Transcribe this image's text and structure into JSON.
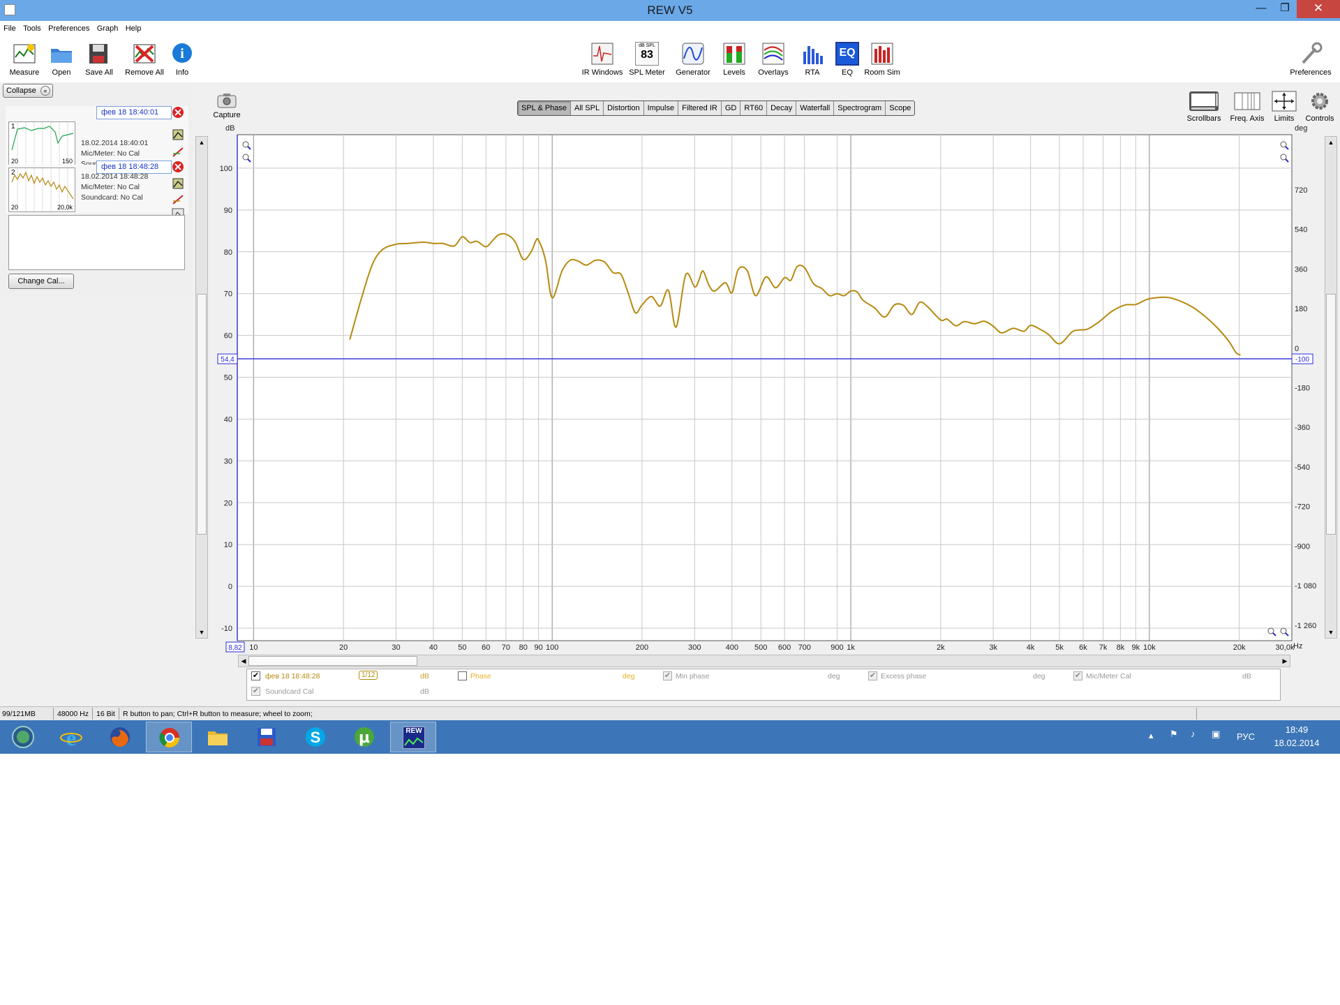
{
  "window": {
    "title": "REW V5",
    "min": "—",
    "max": "❐",
    "close": "✕"
  },
  "menu": [
    "File",
    "Tools",
    "Preferences",
    "Graph",
    "Help"
  ],
  "toolbar": {
    "left": [
      "Measure",
      "Open",
      "Save All",
      "Remove All",
      "Info"
    ],
    "center": [
      "IR Windows",
      "SPL Meter",
      "Generator",
      "Levels",
      "Overlays",
      "RTA",
      "EQ",
      "Room Sim"
    ],
    "spl_value": "83",
    "spl_label": "dB SPL",
    "eq_icon_text": "EQ",
    "right": "Preferences"
  },
  "left_panel": {
    "collapse": "Collapse",
    "measurements": [
      {
        "number": "1",
        "name": "фев 18 18:40:01",
        "date": "18.02.2014 18:40:01",
        "mic": "Mic/Meter: No Cal",
        "soundcard": "Soundcard: No Cal",
        "axis_min": "20",
        "axis_max": "150",
        "trace_color": "#1aa04a"
      },
      {
        "number": "2",
        "name": "фев 18 18:48:28",
        "date": "18.02.2014 18:48:28",
        "mic": "Mic/Meter: No Cal",
        "soundcard": "Soundcard: No Cal",
        "axis_min": "20",
        "axis_max": "20,0k",
        "trace_color": "#b58a10"
      }
    ],
    "change_cal": "Change Cal..."
  },
  "capture": "Capture",
  "tabs": [
    "SPL & Phase",
    "All SPL",
    "Distortion",
    "Impulse",
    "Filtered IR",
    "GD",
    "RT60",
    "Decay",
    "Waterfall",
    "Spectrogram",
    "Scope"
  ],
  "active_tab": "SPL & Phase",
  "right_tools": [
    "Scrollbars",
    "Freq. Axis",
    "Limits",
    "Controls"
  ],
  "chart_data": {
    "type": "line",
    "xscale": "log",
    "xlim": [
      8.82,
      30000
    ],
    "ylim": [
      -13,
      108
    ],
    "y2lim": [
      -1330,
      970
    ],
    "ylabel": "dB",
    "y2label": "deg",
    "xunit": "Hz",
    "grid": true,
    "yticks": [
      100,
      90,
      80,
      70,
      60,
      50,
      40,
      30,
      20,
      10,
      0,
      -10
    ],
    "ytick_labels": [
      "100",
      "90",
      "80",
      "70",
      "60",
      "50",
      "40",
      "30",
      "20",
      "10",
      "0",
      "-10"
    ],
    "y2ticks": [
      720,
      540,
      360,
      180,
      0,
      -180,
      -360,
      -540,
      -720,
      -900,
      -1080,
      -1260
    ],
    "y2tick_labels": [
      "720",
      "540",
      "360",
      "180",
      "0",
      "-180",
      "-360",
      "-540",
      "-720",
      "-900",
      "-1 080",
      "-1 260"
    ],
    "xticks": [
      10,
      20,
      30,
      40,
      50,
      60,
      70,
      80,
      90,
      100,
      200,
      300,
      400,
      500,
      600,
      700,
      900,
      1000,
      2000,
      3000,
      4000,
      5000,
      6000,
      7000,
      8000,
      9000,
      10000,
      20000
    ],
    "xtick_labels": [
      "10",
      "20",
      "30",
      "40",
      "50",
      "60",
      "70",
      "80",
      "90",
      "100",
      "200",
      "300",
      "400",
      "500",
      "600",
      "700",
      "900",
      "1k",
      "2k",
      "3k",
      "4k",
      "5k",
      "6k",
      "7k",
      "8k",
      "9k",
      "10k",
      "20k"
    ],
    "x_min_label": "8,82",
    "x_max_label": "30,0k",
    "cursor": {
      "y": 54.4,
      "left_label": "54,4",
      "right_label": "-100"
    },
    "series": [
      {
        "name": "фев 18 18:48:28",
        "color": "#b58a10",
        "x": [
          21,
          23,
          25,
          27,
          30,
          33,
          37,
          40,
          43,
          47,
          50,
          53,
          56,
          60,
          63,
          66,
          70,
          75,
          80,
          85,
          88,
          90,
          95,
          100,
          108,
          115,
          122,
          130,
          140,
          150,
          160,
          170,
          180,
          190,
          200,
          215,
          230,
          245,
          260,
          280,
          300,
          310,
          320,
          335,
          350,
          380,
          400,
          420,
          450,
          480,
          520,
          560,
          600,
          630,
          660,
          700,
          750,
          800,
          850,
          900,
          950,
          1000,
          1050,
          1100,
          1200,
          1300,
          1400,
          1500,
          1600,
          1700,
          1800,
          2000,
          2100,
          2250,
          2400,
          2600,
          2800,
          3000,
          3200,
          3500,
          3800,
          4000,
          4300,
          4600,
          5000,
          5500,
          5800,
          6200,
          6800,
          7500,
          8300,
          9000,
          9800,
          10500,
          11500,
          12500,
          14000,
          15500,
          17000,
          18500,
          19500,
          20200
        ],
        "y": [
          59,
          69,
          77,
          80.5,
          81.8,
          82,
          82.3,
          82,
          82,
          81.4,
          83.6,
          82.2,
          82.5,
          81.2,
          82.6,
          84,
          84.2,
          82.5,
          78.2,
          80,
          82.5,
          82.8,
          78,
          69,
          75.5,
          78,
          77.8,
          76.8,
          78,
          77.5,
          75,
          74.6,
          70,
          65.4,
          67.3,
          69.3,
          67,
          70.8,
          62,
          74.5,
          71.6,
          73.2,
          75.4,
          72,
          70.6,
          72.6,
          70.2,
          75.8,
          75.5,
          69.5,
          74,
          71.4,
          73.8,
          73.2,
          76.4,
          76.2,
          72.4,
          71.2,
          69.5,
          70,
          69.5,
          70.6,
          70.4,
          68.4,
          66.6,
          64.4,
          67.3,
          67.2,
          65,
          67.9,
          67,
          63.7,
          63.9,
          62.3,
          63.3,
          62.8,
          63.4,
          62.2,
          60.6,
          61.7,
          61,
          62.4,
          61.5,
          60.2,
          58,
          60.8,
          61.3,
          61.5,
          63.3,
          65.8,
          67.3,
          67.4,
          68.6,
          69,
          69.1,
          68.4,
          66.7,
          64.3,
          61.6,
          58.5,
          55.9,
          55.3
        ]
      }
    ]
  },
  "legend": {
    "row1": [
      {
        "label": "фев 18 18:48:28",
        "checked": true,
        "color": "#b58a10"
      },
      {
        "label": "1/12",
        "color": "#b58a10"
      },
      {
        "label": "dB",
        "color": "#c8a030"
      },
      {
        "label": "Phase",
        "checked": false,
        "color": "#e6b020"
      },
      {
        "label": "deg",
        "color": "#e6b020"
      },
      {
        "label": "Min phase",
        "checked": true,
        "color": "#999999"
      },
      {
        "label": "deg",
        "color": "#999999"
      },
      {
        "label": "Excess phase",
        "checked": true,
        "color": "#999999"
      },
      {
        "label": "deg",
        "color": "#999999"
      },
      {
        "label": "Mic/Meter Cal",
        "checked": true,
        "color": "#999999"
      },
      {
        "label": "dB",
        "color": "#999999"
      }
    ],
    "row2": [
      {
        "label": "Soundcard Cal",
        "checked": true,
        "color": "#999999"
      },
      {
        "label": "dB",
        "color": "#999999"
      }
    ]
  },
  "status": {
    "memory": "99/121MB",
    "rate": "48000 Hz",
    "bits": "16 Bit",
    "hint": "R button to pan; Ctrl+R button to measure; wheel to zoom;"
  },
  "taskbar": {
    "time": "18:49",
    "date": "18.02.2014",
    "lang": "РУС",
    "apps": [
      "start",
      "internet-explorer",
      "firefox",
      "chrome",
      "file-explorer",
      "save-app",
      "skype",
      "utorrent",
      "rew"
    ],
    "rew_icon_text": "REW"
  }
}
